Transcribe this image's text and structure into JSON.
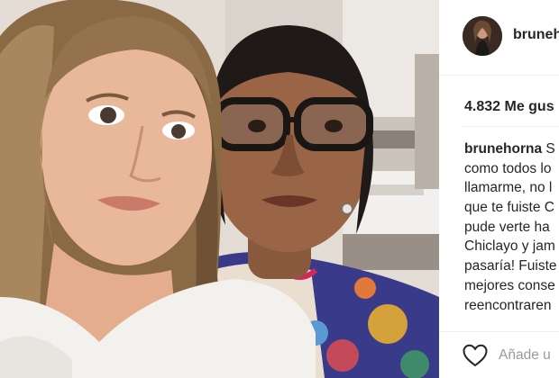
{
  "post": {
    "username": "brunehorna",
    "likes_text": "4.832 Me gus",
    "caption_user": "brunehorna",
    "caption_first_rest": " S",
    "caption_lines": [
      "como todos lo",
      "llamarme, no l",
      "que te fuiste C",
      "pude verte ha",
      "Chiclayo y jam",
      "pasaría! Fuiste",
      "mejores conse",
      "reencontraren"
    ],
    "comment_placeholder": "Añade u"
  },
  "icons": {
    "like": "heart-outline-icon",
    "avatar": "profile-avatar"
  },
  "colors": {
    "text": "#262626",
    "muted": "#999999",
    "border": "#efefef"
  }
}
